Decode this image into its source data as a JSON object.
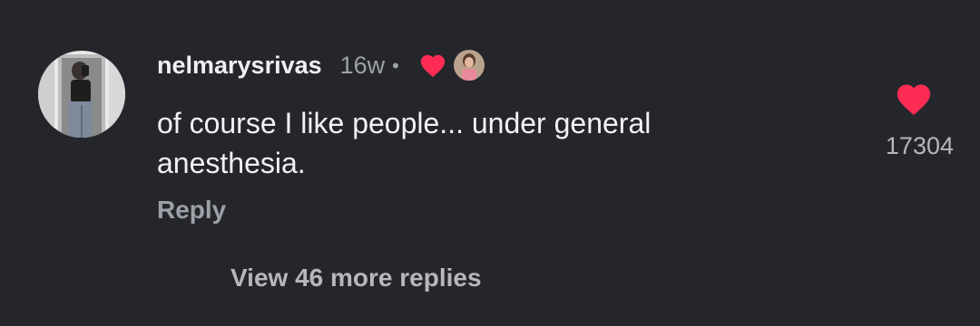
{
  "comment": {
    "username": "nelmarysrivas",
    "timestamp": "16w",
    "separator": "•",
    "text_lines": [
      "of course I like people... under general",
      "anesthesia."
    ],
    "reply_label": "Reply",
    "like_count": "17304",
    "liked_by_creator": true,
    "icons": {
      "creator_like": "heart-icon",
      "like": "heart-icon"
    }
  },
  "replies": {
    "view_more_label": "View 46 more replies"
  },
  "colors": {
    "background": "#25262b",
    "heart": "#fe2c55",
    "primary_text": "#f2f2f4",
    "secondary_text": "#9ea0a8"
  }
}
